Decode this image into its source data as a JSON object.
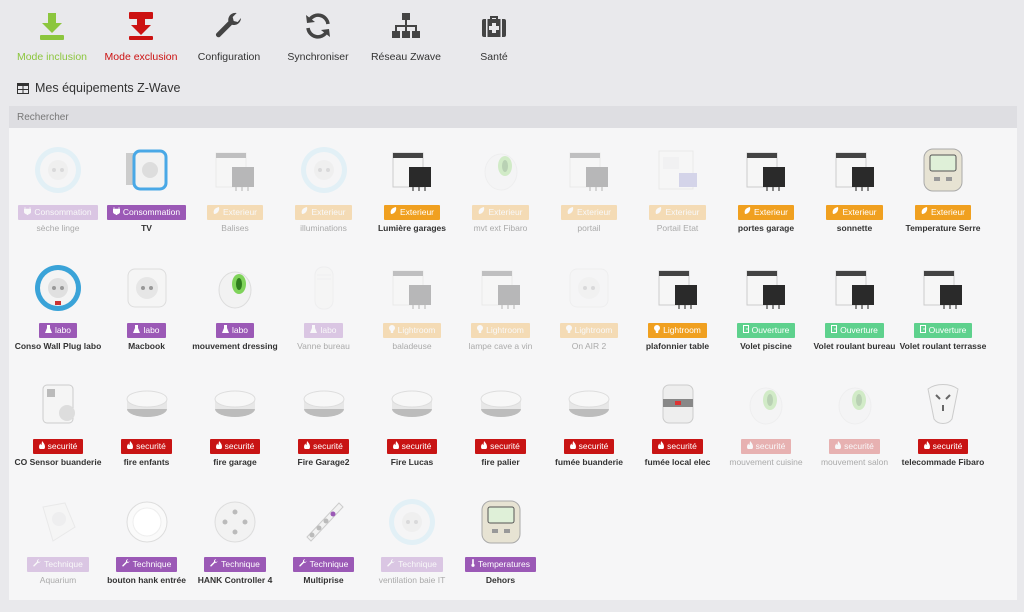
{
  "toolbar": [
    {
      "label": "Mode inclusion",
      "icon": "download-icon",
      "color": "#8cc63e"
    },
    {
      "label": "Mode exclusion",
      "icon": "upload-red-icon",
      "color": "#cc1111"
    },
    {
      "label": "Configuration",
      "icon": "wrench-icon",
      "color": "#444444"
    },
    {
      "label": "Synchroniser",
      "icon": "refresh-icon",
      "color": "#444444"
    },
    {
      "label": "Réseau Zwave",
      "icon": "sitemap-icon",
      "color": "#444444"
    },
    {
      "label": "Santé",
      "icon": "medkit-icon",
      "color": "#444444"
    }
  ],
  "section_title": "Mes équipements Z-Wave",
  "search_placeholder": "Rechercher",
  "categories": {
    "conso": {
      "color": "#9b59b6",
      "icon": "plug-icon"
    },
    "exterieur": {
      "color": "#f0a020",
      "icon": "leaf-icon"
    },
    "labo": {
      "color": "#9b59b6",
      "icon": "flask-icon"
    },
    "lightroom": {
      "color": "#f0a020",
      "icon": "lightbulb-icon"
    },
    "ouverture": {
      "color": "#5ed18d",
      "icon": "door-icon"
    },
    "securite": {
      "color": "#c81414",
      "icon": "fire-icon"
    },
    "technique": {
      "color": "#9b59b6",
      "icon": "wrench-small-icon"
    },
    "temperature": {
      "color": "#9b59b6",
      "icon": "thermometer-icon"
    }
  },
  "rows": [
    [
      {
        "name": "sèche linge",
        "badge": "Consommation",
        "cat": "conso",
        "img": "plug-ring",
        "enabled": false
      },
      {
        "name": "TV",
        "badge": "Consommation",
        "cat": "conso",
        "img": "plug-square",
        "enabled": true
      },
      {
        "name": "Balises",
        "badge": "Exterieur",
        "cat": "exterieur",
        "img": "module-box",
        "enabled": false
      },
      {
        "name": "illuminations",
        "badge": "Exterieur",
        "cat": "exterieur",
        "img": "plug-ring",
        "enabled": false
      },
      {
        "name": "Lumière garages",
        "badge": "Exterieur",
        "cat": "exterieur",
        "img": "module-box",
        "enabled": true
      },
      {
        "name": "mvt ext Fibaro",
        "badge": "Exterieur",
        "cat": "exterieur",
        "img": "motion-eye",
        "enabled": false
      },
      {
        "name": "portail",
        "badge": "Exterieur",
        "cat": "exterieur",
        "img": "module-box",
        "enabled": false
      },
      {
        "name": "Portail Etat",
        "badge": "Exterieur",
        "cat": "exterieur",
        "img": "kit-box",
        "enabled": false
      },
      {
        "name": "portes garage",
        "badge": "Exterieur",
        "cat": "exterieur",
        "img": "module-box",
        "enabled": true
      },
      {
        "name": "sonnette",
        "badge": "Exterieur",
        "cat": "exterieur",
        "img": "module-box",
        "enabled": true
      },
      {
        "name": "Temperature Serre",
        "badge": "Exterieur",
        "cat": "exterieur",
        "img": "thermostat",
        "enabled": true
      }
    ],
    [
      {
        "name": "Conso Wall Plug labo",
        "badge": "labo",
        "cat": "labo",
        "img": "plug-ring-blue",
        "enabled": true
      },
      {
        "name": "Macbook",
        "badge": "labo",
        "cat": "labo",
        "img": "plug-white",
        "enabled": true
      },
      {
        "name": "mouvement dressing",
        "badge": "labo",
        "cat": "labo",
        "img": "motion-eye",
        "enabled": true
      },
      {
        "name": "Vanne bureau",
        "badge": "labo",
        "cat": "labo",
        "img": "valve",
        "enabled": false
      },
      {
        "name": "baladeuse",
        "badge": "Lightroom",
        "cat": "lightroom",
        "img": "module-box",
        "enabled": false
      },
      {
        "name": "lampe cave a vin",
        "badge": "Lightroom",
        "cat": "lightroom",
        "img": "module-box",
        "enabled": false
      },
      {
        "name": "On AIR 2",
        "badge": "Lightroom",
        "cat": "lightroom",
        "img": "plug-white",
        "enabled": false
      },
      {
        "name": "plafonnier table",
        "badge": "Lightroom",
        "cat": "lightroom",
        "img": "module-box",
        "enabled": true
      },
      {
        "name": "Volet piscine",
        "badge": "Ouverture",
        "cat": "ouverture",
        "img": "module-box",
        "enabled": true
      },
      {
        "name": "Volet roulant bureau",
        "badge": "Ouverture",
        "cat": "ouverture",
        "img": "module-box",
        "enabled": true
      },
      {
        "name": "Volet roulant terrasse",
        "badge": "Ouverture",
        "cat": "ouverture",
        "img": "module-box",
        "enabled": true
      }
    ],
    [
      {
        "name": "CO Sensor buanderie",
        "badge": "securité",
        "cat": "securite",
        "img": "co-sensor",
        "enabled": true
      },
      {
        "name": "fire enfants",
        "badge": "securité",
        "cat": "securite",
        "img": "smoke",
        "enabled": true
      },
      {
        "name": "fire garage",
        "badge": "securité",
        "cat": "securite",
        "img": "smoke",
        "enabled": true
      },
      {
        "name": "Fire Garage2",
        "badge": "securité",
        "cat": "securite",
        "img": "smoke",
        "enabled": true
      },
      {
        "name": "Fire Lucas",
        "badge": "securité",
        "cat": "securite",
        "img": "smoke",
        "enabled": true
      },
      {
        "name": "fire palier",
        "badge": "securité",
        "cat": "securite",
        "img": "smoke",
        "enabled": true
      },
      {
        "name": "fumée buanderie",
        "badge": "securité",
        "cat": "securite",
        "img": "smoke",
        "enabled": true
      },
      {
        "name": "fumée local elec",
        "badge": "securité",
        "cat": "securite",
        "img": "smoke-tall",
        "enabled": true
      },
      {
        "name": "mouvement cuisine",
        "badge": "securité",
        "cat": "securite",
        "img": "motion-eye",
        "enabled": false
      },
      {
        "name": "mouvement salon",
        "badge": "securité",
        "cat": "securite",
        "img": "motion-eye",
        "enabled": false
      },
      {
        "name": "telecommade Fibaro",
        "badge": "securité",
        "cat": "securite",
        "img": "remote",
        "enabled": true
      }
    ],
    [
      {
        "name": "Aquarium",
        "badge": "Technique",
        "cat": "technique",
        "img": "plug-angled",
        "enabled": false
      },
      {
        "name": "bouton hank entrée",
        "badge": "Technique",
        "cat": "technique",
        "img": "button-round",
        "enabled": true
      },
      {
        "name": "HANK Controller 4",
        "badge": "Technique",
        "cat": "technique",
        "img": "controller",
        "enabled": true
      },
      {
        "name": "Multiprise",
        "badge": "Technique",
        "cat": "technique",
        "img": "strip",
        "enabled": true
      },
      {
        "name": "ventilation baie IT",
        "badge": "Technique",
        "cat": "technique",
        "img": "plug-ring",
        "enabled": false
      },
      {
        "name": "Dehors",
        "badge": "Temperatures",
        "cat": "temperature",
        "img": "thermostat",
        "enabled": true
      }
    ]
  ]
}
